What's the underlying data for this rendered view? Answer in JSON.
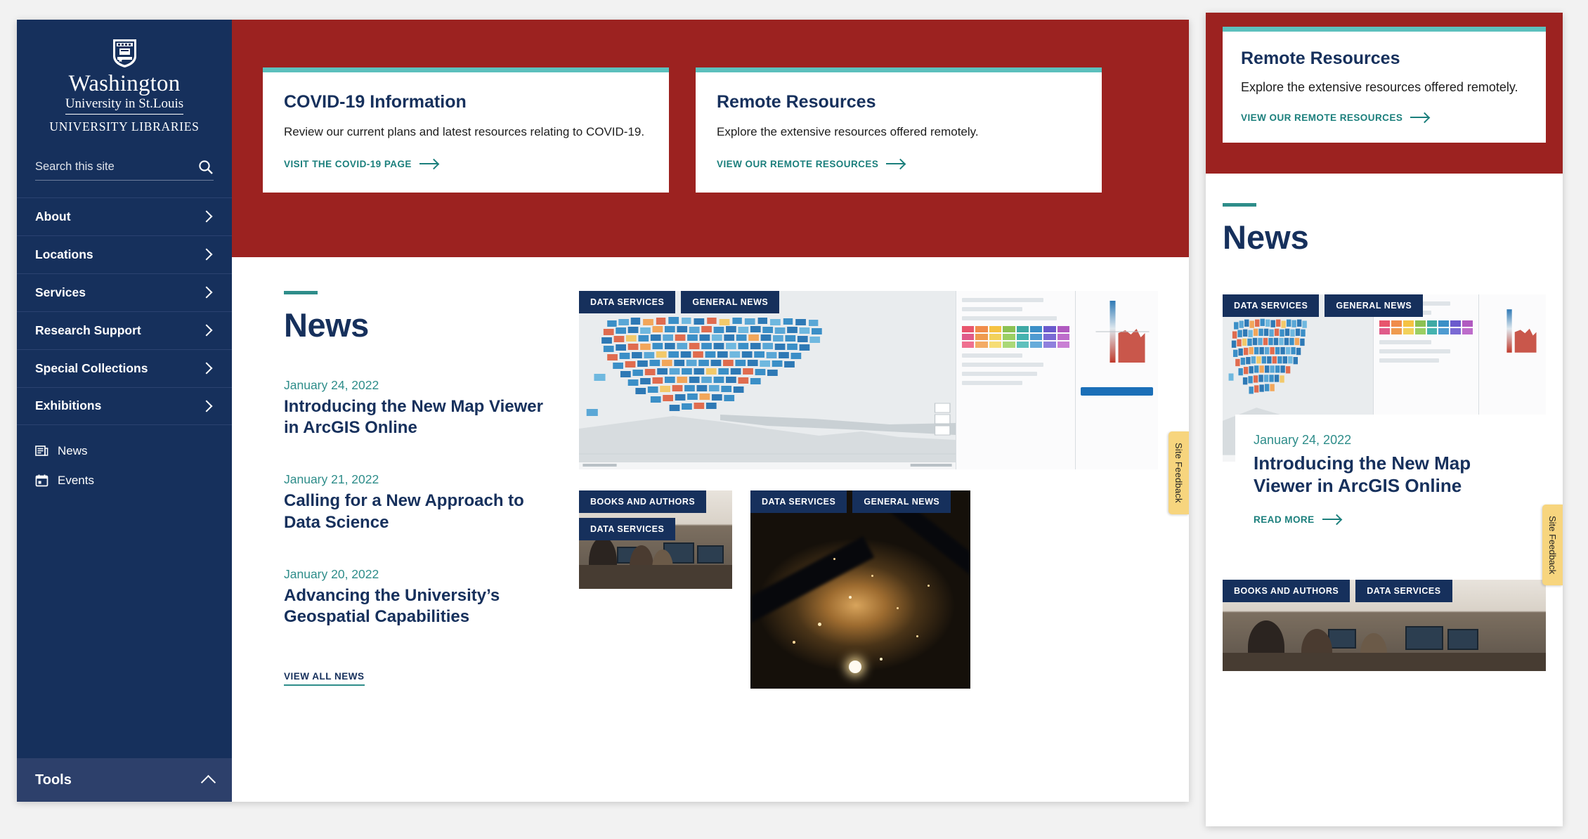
{
  "brand": {
    "line1": "Washington",
    "line2": "University in St.Louis",
    "line3": "UNIVERSITY LIBRARIES",
    "shield_icon": "shield-crest-icon"
  },
  "colors": {
    "navy": "#16305c",
    "red": "#9c2220",
    "teal": "#5cc0bd",
    "teal_text": "#1b7f7c",
    "green_date": "#2e8d8a",
    "tools_bar": "#2d406b",
    "feedback_yellow": "#f7d57e"
  },
  "search": {
    "placeholder": "Search this site",
    "value": "",
    "icon": "search-icon"
  },
  "sidebar": {
    "nav": [
      {
        "label": "About",
        "icon": "chevron-right-icon"
      },
      {
        "label": "Locations",
        "icon": "chevron-right-icon"
      },
      {
        "label": "Services",
        "icon": "chevron-right-icon"
      },
      {
        "label": "Research Support",
        "icon": "chevron-right-icon"
      },
      {
        "label": "Special Collections",
        "icon": "chevron-right-icon"
      },
      {
        "label": "Exhibitions",
        "icon": "chevron-right-icon"
      }
    ],
    "sub_nav": [
      {
        "label": "News",
        "icon": "newspaper-icon"
      },
      {
        "label": "Events",
        "icon": "calendar-icon"
      }
    ],
    "tools": {
      "label": "Tools",
      "icon": "chevron-up-icon"
    }
  },
  "promos": [
    {
      "title": "COVID-19 Information",
      "desc": "Review our current plans and latest resources relating to COVID-19.",
      "link": "VISIT THE COVID-19 PAGE",
      "link_icon": "arrow-right-icon"
    },
    {
      "title": "Remote Resources",
      "desc": "Explore the extensive resources offered remotely.",
      "link": "VIEW OUR REMOTE RESOURCES",
      "link_icon": "arrow-right-icon"
    }
  ],
  "news": {
    "heading": "News",
    "articles": [
      {
        "date": "January 24, 2022",
        "title": "Introducing the New Map Viewer in ArcGIS Online"
      },
      {
        "date": "January 21, 2022",
        "title": "Calling for a New Approach to Data Science"
      },
      {
        "date": "January 20, 2022",
        "title": "Advancing the University’s Geospatial Capabilities"
      }
    ],
    "view_all": "VIEW ALL NEWS",
    "tiles": [
      {
        "image": "us-choropleth-map-screenshot",
        "badges": [
          "DATA SERVICES",
          "GENERAL NEWS"
        ]
      },
      {
        "image": "library-staff-at-computers-photo",
        "badges": [
          "BOOKS AND AUTHORS",
          "DATA SERVICES"
        ]
      },
      {
        "image": "city-at-night-from-space-photo",
        "badges": [
          "DATA SERVICES",
          "GENERAL NEWS"
        ]
      }
    ]
  },
  "feedback": {
    "label": "Site Feedback"
  },
  "mobile": {
    "promo": {
      "title": "Remote Resources",
      "desc": "Explore the extensive resources offered remotely.",
      "link": "VIEW OUR REMOTE RESOURCES",
      "link_icon": "arrow-right-icon"
    },
    "news_heading": "News",
    "featured": {
      "badges": [
        "DATA SERVICES",
        "GENERAL NEWS"
      ],
      "date": "January 24, 2022",
      "title": "Introducing the New Map Viewer in ArcGIS Online",
      "read_more": "READ MORE",
      "read_more_icon": "arrow-right-icon"
    },
    "next_tile": {
      "badges": [
        "BOOKS AND AUTHORS",
        "DATA SERVICES"
      ]
    },
    "feedback": {
      "label": "Site Feedback"
    }
  }
}
